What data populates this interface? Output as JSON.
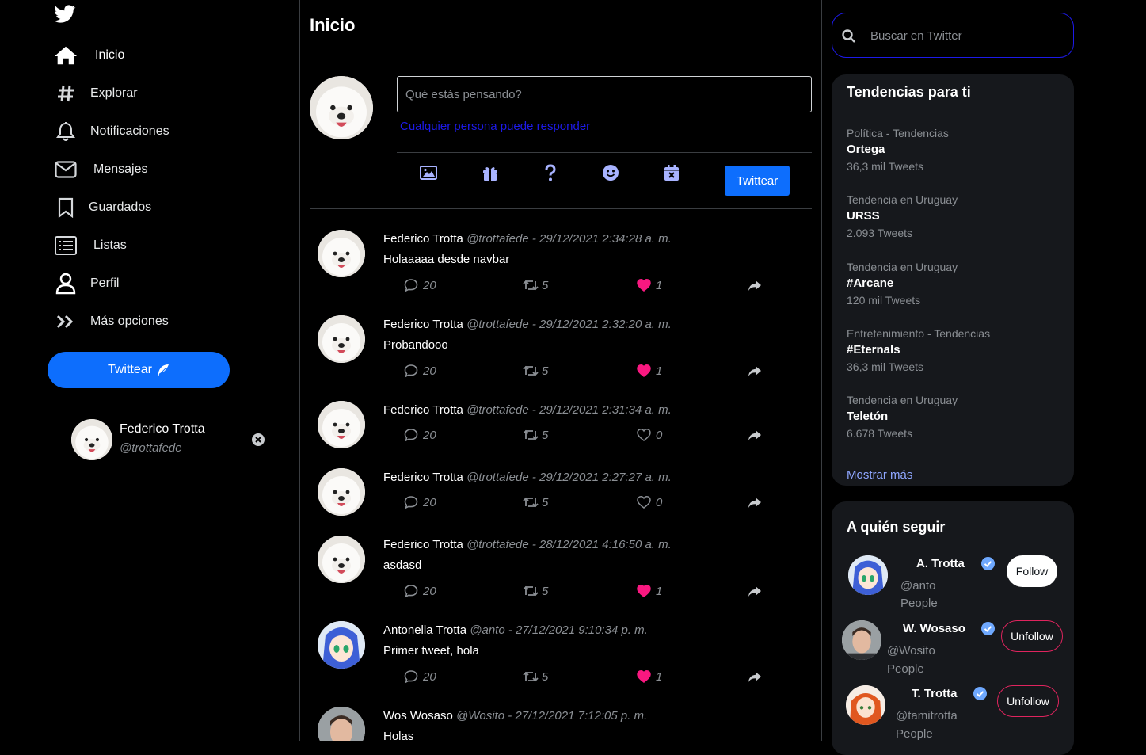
{
  "sidebar": {
    "nav": [
      {
        "label": "Inicio",
        "icon": "home-icon"
      },
      {
        "label": "Explorar",
        "icon": "hashtag-icon"
      },
      {
        "label": "Notificaciones",
        "icon": "bell-icon"
      },
      {
        "label": "Mensajes",
        "icon": "envelope-icon"
      },
      {
        "label": "Guardados",
        "icon": "bookmark-icon"
      },
      {
        "label": "Listas",
        "icon": "list-icon"
      },
      {
        "label": "Perfil",
        "icon": "user-icon"
      },
      {
        "label": "Más opciones",
        "icon": "double-chevron-icon"
      }
    ],
    "tweet_button": "Twittear",
    "user": {
      "name": "Federico Trotta",
      "handle": "@trottafede"
    }
  },
  "feed": {
    "title": "Inicio",
    "compose": {
      "placeholder": "Qué estás pensando?",
      "reply_setting": "Cualquier persona puede responder",
      "button": "Twittear",
      "tools": [
        "image-icon",
        "gift-icon",
        "question-icon",
        "smile-icon",
        "calendar-x-icon"
      ]
    },
    "tweets": [
      {
        "name": "Federico Trotta",
        "meta": "@trottafede - 29/12/2021 2:34:28 a. m.",
        "text": "Holaaaaa desde navbar",
        "replies": "20",
        "retweets": "5",
        "likes": "1",
        "liked": true
      },
      {
        "name": "Federico Trotta",
        "meta": "@trottafede - 29/12/2021 2:32:20 a. m.",
        "text": "Probandooo",
        "replies": "20",
        "retweets": "5",
        "likes": "1",
        "liked": true
      },
      {
        "name": "Federico Trotta",
        "meta": "@trottafede - 29/12/2021 2:31:34 a. m.",
        "text": "",
        "replies": "20",
        "retweets": "5",
        "likes": "0",
        "liked": false
      },
      {
        "name": "Federico Trotta",
        "meta": "@trottafede - 29/12/2021 2:27:27 a. m.",
        "text": "",
        "replies": "20",
        "retweets": "5",
        "likes": "0",
        "liked": false
      },
      {
        "name": "Federico Trotta",
        "meta": "@trottafede - 28/12/2021 4:16:50 a. m.",
        "text": "asdasd",
        "replies": "20",
        "retweets": "5",
        "likes": "1",
        "liked": true
      },
      {
        "name": "Antonella Trotta",
        "meta": "@anto - 27/12/2021 9:10:34 p. m.",
        "text": "Primer tweet, hola",
        "replies": "20",
        "retweets": "5",
        "likes": "1",
        "liked": true
      },
      {
        "name": "Wos Wosaso",
        "meta": "@Wosito - 27/12/2021 7:12:05 p. m.",
        "text": "Holas",
        "replies": "",
        "retweets": "",
        "likes": "",
        "liked": false
      }
    ]
  },
  "right": {
    "search_placeholder": "Buscar en Twitter",
    "trends_title": "Tendencias para ti",
    "trends": [
      {
        "category": "Política - Tendencias",
        "topic": "Ortega",
        "count": "36,3 mil Tweets"
      },
      {
        "category": "Tendencia en Uruguay",
        "topic": "URSS",
        "count": "2.093 Tweets"
      },
      {
        "category": "Tendencia en Uruguay",
        "topic": "#Arcane",
        "count": "120 mil Tweets"
      },
      {
        "category": "Entretenimiento - Tendencias",
        "topic": "#Eternals",
        "count": "36,3 mil Tweets"
      },
      {
        "category": "Tendencia en Uruguay",
        "topic": "Teletón",
        "count": "6.678 Tweets"
      }
    ],
    "show_more": "Mostrar más",
    "follow_title": "A quién seguir",
    "follow": [
      {
        "name": "A. Trotta",
        "handle": "@anto",
        "type": "People",
        "button": "Follow"
      },
      {
        "name": "W. Wosaso",
        "handle": "@Wosito",
        "type": "People",
        "button": "Unfollow"
      },
      {
        "name": "T. Trotta",
        "handle": "@tamitrotta",
        "type": "People",
        "button": "Unfollow"
      }
    ]
  },
  "colors": {
    "accent": "#0d6efd",
    "like": "#f91880",
    "link": "#1d1ae8",
    "panel": "#16181c",
    "verified": "#1d9bf0"
  }
}
